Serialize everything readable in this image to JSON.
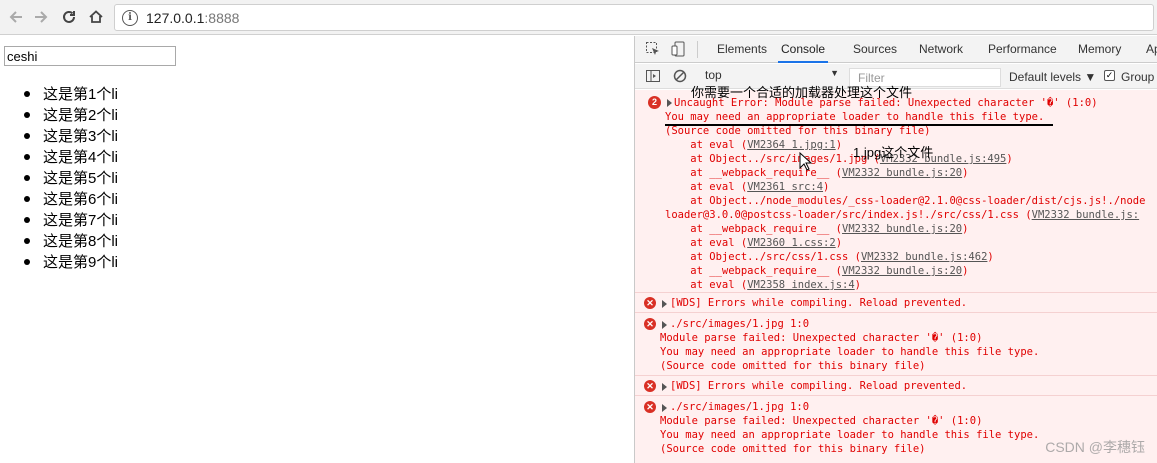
{
  "browser": {
    "url_host": "127.0.0.1",
    "url_port": ":8888"
  },
  "page": {
    "input_value": "ceshi",
    "items": [
      "这是第1个li",
      "这是第2个li",
      "这是第3个li",
      "这是第4个li",
      "这是第5个li",
      "这是第6个li",
      "这是第7个li",
      "这是第8个li",
      "这是第9个li"
    ]
  },
  "devtools": {
    "tabs": [
      "Elements",
      "Console",
      "Sources",
      "Network",
      "Performance",
      "Memory",
      "Ap"
    ],
    "active_tab": "Console",
    "context": "top",
    "filter_placeholder": "Filter",
    "levels_label": "Default levels ▼",
    "group_label": "Group",
    "error_count": "2",
    "first_error": {
      "title": "Uncaught Error: Module parse failed: Unexpected character '�' (1:0)",
      "loader_hint": "You may need an appropriate loader to handle this file type.",
      "omitted": "(Source code omitted for this binary file)",
      "stack": [
        {
          "prefix": "    at eval (",
          "link": "VM2364 1.jpg:1",
          "suffix": ")"
        },
        {
          "prefix": "    at Object../src/images/1.jpg (",
          "link": "VM2332 bundle.js:495",
          "suffix": ")"
        },
        {
          "prefix": "    at __webpack_require__ (",
          "link": "VM2332 bundle.js:20",
          "suffix": ")"
        },
        {
          "prefix": "    at eval (",
          "link": "VM2361 src:4",
          "suffix": ")"
        },
        {
          "prefix": "    at Object../node_modules/_css-loader@2.1.0@css-loader/dist/cjs.js!./node",
          "link": "",
          "suffix": ""
        },
        {
          "prefix": "loader@3.0.0@postcss-loader/src/index.js!./src/css/1.css (",
          "link": "VM2332 bundle.js:",
          "suffix": ""
        },
        {
          "prefix": "    at __webpack_require__ (",
          "link": "VM2332 bundle.js:20",
          "suffix": ")"
        },
        {
          "prefix": "    at eval (",
          "link": "VM2360 1.css:2",
          "suffix": ")"
        },
        {
          "prefix": "    at Object../src/css/1.css (",
          "link": "VM2332 bundle.js:462",
          "suffix": ")"
        },
        {
          "prefix": "    at __webpack_require__ (",
          "link": "VM2332 bundle.js:20",
          "suffix": ")"
        },
        {
          "prefix": "    at eval (",
          "link": "VM2358 index.js:4",
          "suffix": ")"
        }
      ]
    },
    "wds_1": "[WDS] Errors while compiling. Reload prevented.",
    "module_1": {
      "path": "./src/images/1.jpg 1:0",
      "line1": "Module parse failed: Unexpected character '�' (1:0)",
      "line2": "You may need an appropriate loader to handle this file type.",
      "line3": "(Source code omitted for this binary file)"
    },
    "wds_2": "[WDS] Errors while compiling. Reload prevented.",
    "module_2": {
      "path": "./src/images/1.jpg 1:0",
      "line1": "Module parse failed: Unexpected character '�' (1:0)",
      "line2": "You may need an appropriate loader to handle this file type.",
      "line3": "(Source code omitted for this binary file)"
    }
  },
  "annotations": {
    "loader_note": "你需要一个合适的加载器处理这个文件",
    "jpg_note": "1.jpg这个文件"
  },
  "watermark": "CSDN @李穗钰",
  "icons": {
    "back": "back-arrow-icon",
    "forward": "forward-arrow-icon",
    "reload": "reload-icon",
    "home": "home-icon",
    "info": "info-icon",
    "inspect": "inspect-element-icon",
    "device": "device-toolbar-icon",
    "sidebar": "console-sidebar-icon",
    "clear": "clear-console-icon",
    "error": "error-circle-icon"
  },
  "colors": {
    "error_text": "#e00000",
    "error_bg": "#fff0f0",
    "active_tab": "#1a73e8"
  }
}
